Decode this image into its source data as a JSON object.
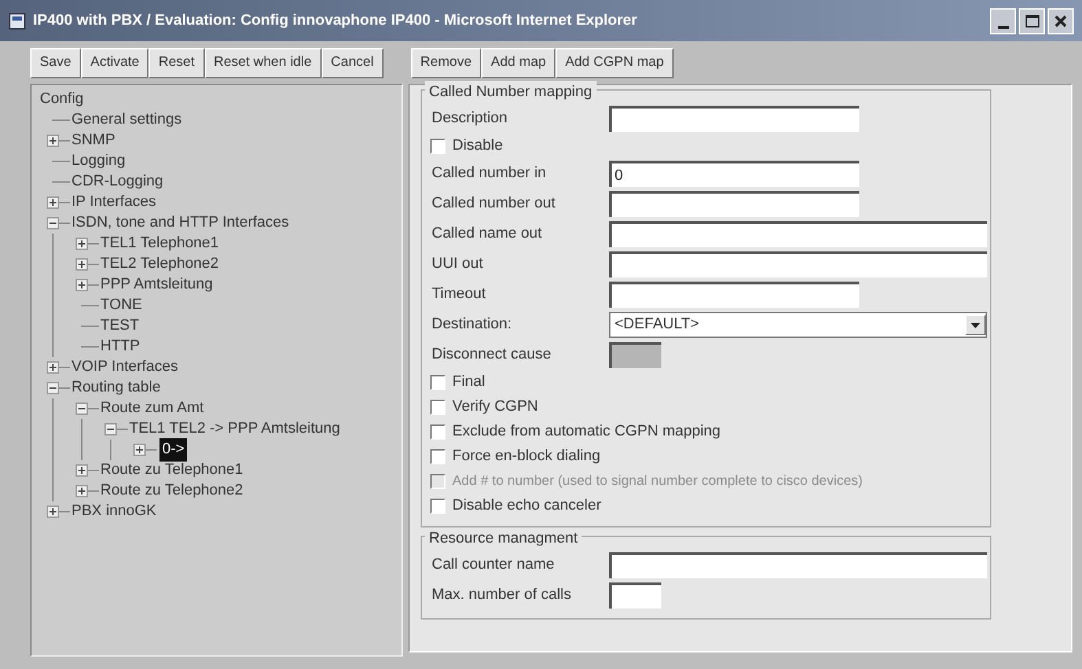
{
  "window": {
    "title": "IP400 with  PBX / Evaluation: Config innovaphone IP400 - Microsoft Internet Explorer"
  },
  "toolbar": {
    "left_buttons": [
      "Save",
      "Activate",
      "Reset",
      "Reset when idle",
      "Cancel"
    ],
    "right_buttons": [
      "Remove",
      "Add map",
      "Add CGPN map"
    ]
  },
  "tree": {
    "label": "Config",
    "selected": false,
    "children": [
      {
        "label": "General settings",
        "selected": false
      },
      {
        "label": "SNMP",
        "selected": false,
        "expanded": false
      },
      {
        "label": "Logging",
        "selected": false
      },
      {
        "label": "CDR-Logging",
        "selected": false
      },
      {
        "label": "IP Interfaces",
        "selected": false,
        "expanded": false
      },
      {
        "label": "ISDN, tone and HTTP Interfaces",
        "selected": false,
        "expanded": true,
        "children": [
          {
            "label": "TEL1 Telephone1",
            "selected": false,
            "expanded": false
          },
          {
            "label": "TEL2 Telephone2",
            "selected": false,
            "expanded": false
          },
          {
            "label": "PPP Amtsleitung",
            "selected": false,
            "expanded": false
          },
          {
            "label": "TONE",
            "selected": false
          },
          {
            "label": "TEST",
            "selected": false
          },
          {
            "label": "HTTP",
            "selected": false
          }
        ]
      },
      {
        "label": "VOIP Interfaces",
        "selected": false,
        "expanded": false
      },
      {
        "label": "Routing table",
        "selected": false,
        "expanded": true,
        "children": [
          {
            "label": "Route zum Amt",
            "selected": false,
            "expanded": true,
            "children": [
              {
                "label": "TEL1  TEL2 -> PPP Amtsleitung",
                "selected": false,
                "expanded": true,
                "children": [
                  {
                    "label": "0->",
                    "selected": true,
                    "expanded": false
                  }
                ]
              }
            ]
          },
          {
            "label": "Route zu Telephone1",
            "selected": false,
            "expanded": false
          },
          {
            "label": "Route zu Telephone2",
            "selected": false,
            "expanded": false
          }
        ]
      },
      {
        "label": "PBX innoGK",
        "selected": false,
        "expanded": false
      }
    ]
  },
  "called_number_mapping": {
    "legend": "Called Number mapping",
    "rows": [
      {
        "kind": "field",
        "label": "Description",
        "value": ""
      },
      {
        "kind": "checkbox",
        "label": "Disable",
        "checked": false,
        "disabled": false
      },
      {
        "kind": "field",
        "label": "Called number in",
        "value": "0"
      },
      {
        "kind": "field",
        "label": "Called number out",
        "value": ""
      },
      {
        "kind": "widefield",
        "label": "Called name out",
        "value": ""
      },
      {
        "kind": "widefield",
        "label": "UUI out",
        "value": ""
      },
      {
        "kind": "field",
        "label": "Timeout",
        "value": ""
      },
      {
        "kind": "select",
        "label": "Destination:",
        "value": "<DEFAULT>"
      },
      {
        "kind": "shortfield",
        "label": "Disconnect cause",
        "value": "",
        "disabled": true
      },
      {
        "kind": "checkbox",
        "label": "Final",
        "checked": false,
        "disabled": false
      },
      {
        "kind": "checkbox",
        "label": "Verify CGPN",
        "checked": false,
        "disabled": false
      },
      {
        "kind": "checkbox",
        "label": "Exclude from automatic CGPN mapping",
        "checked": false,
        "disabled": false
      },
      {
        "kind": "checkbox",
        "label": "Force en-block dialing",
        "checked": false,
        "disabled": false
      },
      {
        "kind": "checkbox",
        "label": "Add # to number (used to signal number complete to cisco devices)",
        "checked": false,
        "disabled": true
      },
      {
        "kind": "checkbox",
        "label": "Disable echo canceler",
        "checked": false,
        "disabled": false
      }
    ]
  },
  "resource_management": {
    "legend": "Resource managment",
    "rows": [
      {
        "kind": "widefield",
        "label": "Call counter name",
        "value": ""
      },
      {
        "kind": "shortfield",
        "label": "Max. number of calls",
        "value": ""
      }
    ]
  }
}
